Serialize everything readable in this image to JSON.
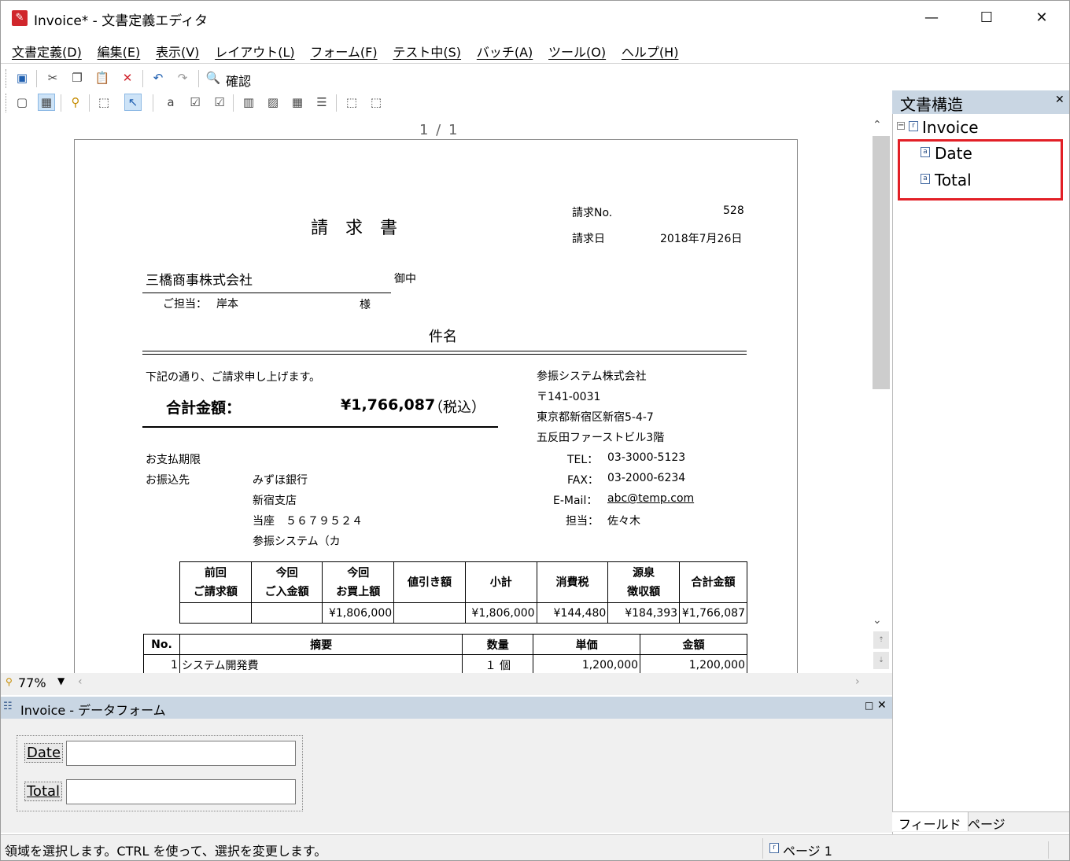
{
  "window": {
    "title": "Invoice* - 文書定義エディタ",
    "minimize": "—",
    "maximize": "☐",
    "close": "✕"
  },
  "menu": [
    "文書定義(D)",
    "編集(E)",
    "表示(V)",
    "レイアウト(L)",
    "フォーム(F)",
    "テスト中(S)",
    "バッチ(A)",
    "ツール(O)",
    "ヘルプ(H)"
  ],
  "toolbar": {
    "confirm_label": "確認"
  },
  "viewer": {
    "page_indicator": "1 / 1",
    "zoom": "77%"
  },
  "invoice": {
    "heading": "請　求　書",
    "no_label": "請求No.",
    "no_value": "528",
    "date_label": "請求日",
    "date_value": "2018年7月26日",
    "customer": "三橋商事株式会社",
    "customer_suffix": "御中",
    "contact_label": "ご担当：",
    "contact_name": "岸本",
    "contact_suffix": "様",
    "subject_label": "件名",
    "intro": "下記の通り、ご請求申し上げます。",
    "total_label": "合計金額：",
    "total_value": "¥1,766,087",
    "total_tax": "（税込）",
    "due_label": "お支払期限",
    "bank_label": "お振込先",
    "bank_name": "みずほ銀行",
    "bank_branch": "新宿支店",
    "bank_account": "当座　５６７９５２４",
    "bank_holder": "参振システム（カ",
    "company": "参振システム株式会社",
    "zip": "〒141-0031",
    "address1": "東京都新宿区新宿5-4-7",
    "address2": "五反田ファーストビル3階",
    "tel_label": "TEL：",
    "tel": "03-3000-5123",
    "fax_label": "FAX：",
    "fax": "03-2000-6234",
    "email_label": "E-Mail：",
    "email": "abc@temp.com",
    "rep_label": "担当：",
    "rep": "佐々木",
    "summary_headers": [
      [
        "前回",
        "ご請求額"
      ],
      [
        "今回",
        "ご入金額"
      ],
      [
        "今回",
        "お買上額"
      ],
      [
        "値引き額",
        ""
      ],
      [
        "小計",
        ""
      ],
      [
        "消費税",
        ""
      ],
      [
        "源泉",
        "徴収額"
      ],
      [
        "合計金額",
        ""
      ]
    ],
    "summary_values": [
      "",
      "",
      "¥1,806,000",
      "",
      "¥1,806,000",
      "¥144,480",
      "¥184,393",
      "¥1,766,087"
    ],
    "detail_headers": [
      "No.",
      "摘要",
      "数量",
      "単価",
      "金額"
    ],
    "detail_rows": [
      [
        "1",
        "システム開発費",
        "１ 個",
        "1,200,000",
        "1,200,000"
      ]
    ]
  },
  "dataform": {
    "title": "Invoice - データフォーム",
    "date_label": "Date",
    "total_label": "Total",
    "date_value": "",
    "total_value": ""
  },
  "structure": {
    "title": "文書構造",
    "root": "Invoice",
    "items": [
      "Date",
      "Total"
    ],
    "tab_fields": "フィールド",
    "tab_page": "ページ"
  },
  "status": {
    "message": "領域を選択します。CTRL を使って、選択を変更します。",
    "page": "ページ 1"
  },
  "colors": {
    "highlight_box": "#e21f26",
    "panel_header": "#c9d6e3"
  }
}
